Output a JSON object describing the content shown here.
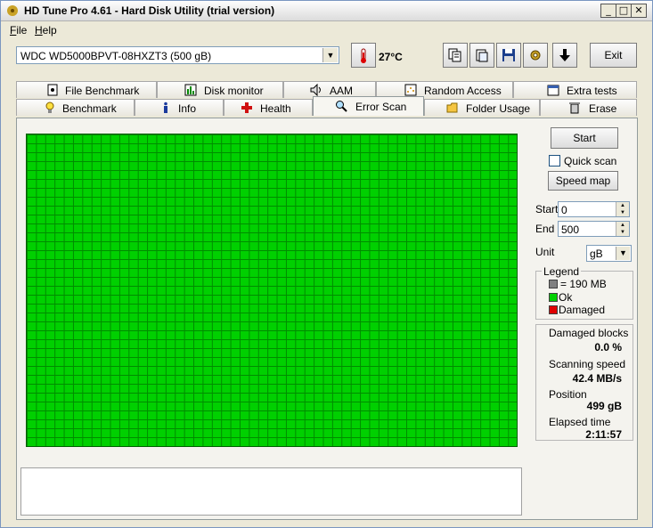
{
  "window": {
    "title": "HD Tune Pro 4.61 - Hard Disk Utility (trial version)"
  },
  "menu": [
    {
      "label": "File",
      "key": "F"
    },
    {
      "label": "Help",
      "key": "H"
    }
  ],
  "toolbar": {
    "drive": "WDC WD5000BPVT-08HXZT3 (500 gB)",
    "temperature": "27°C",
    "exit_label": "Exit"
  },
  "tabs": {
    "row1": [
      "File Benchmark",
      "Disk monitor",
      "AAM",
      "Random Access",
      "Extra tests"
    ],
    "row2": [
      "Benchmark",
      "Info",
      "Health",
      "Error Scan",
      "Folder Usage",
      "Erase"
    ]
  },
  "scan": {
    "start_label": "Start",
    "quick_scan_label": "Quick scan",
    "quick_scan_checked": false,
    "speed_map_label": "Speed map",
    "start_field_label": "Start",
    "start_value": "0",
    "end_field_label": "End",
    "end_value": "500",
    "unit_label": "Unit",
    "unit_value": "gB"
  },
  "legend": {
    "title": "Legend",
    "block": "= 190 MB",
    "ok": "Ok",
    "damaged": "Damaged",
    "colors": {
      "block": "#808080",
      "ok": "#00d000",
      "damaged": "#e00000"
    }
  },
  "stats": {
    "damaged_label": "Damaged blocks",
    "damaged_value": "0.0 %",
    "speed_label": "Scanning speed",
    "speed_value": "42.4 MB/s",
    "position_label": "Position",
    "position_value": "499 gB",
    "elapsed_label": "Elapsed time",
    "elapsed_value": "2:11:57"
  }
}
